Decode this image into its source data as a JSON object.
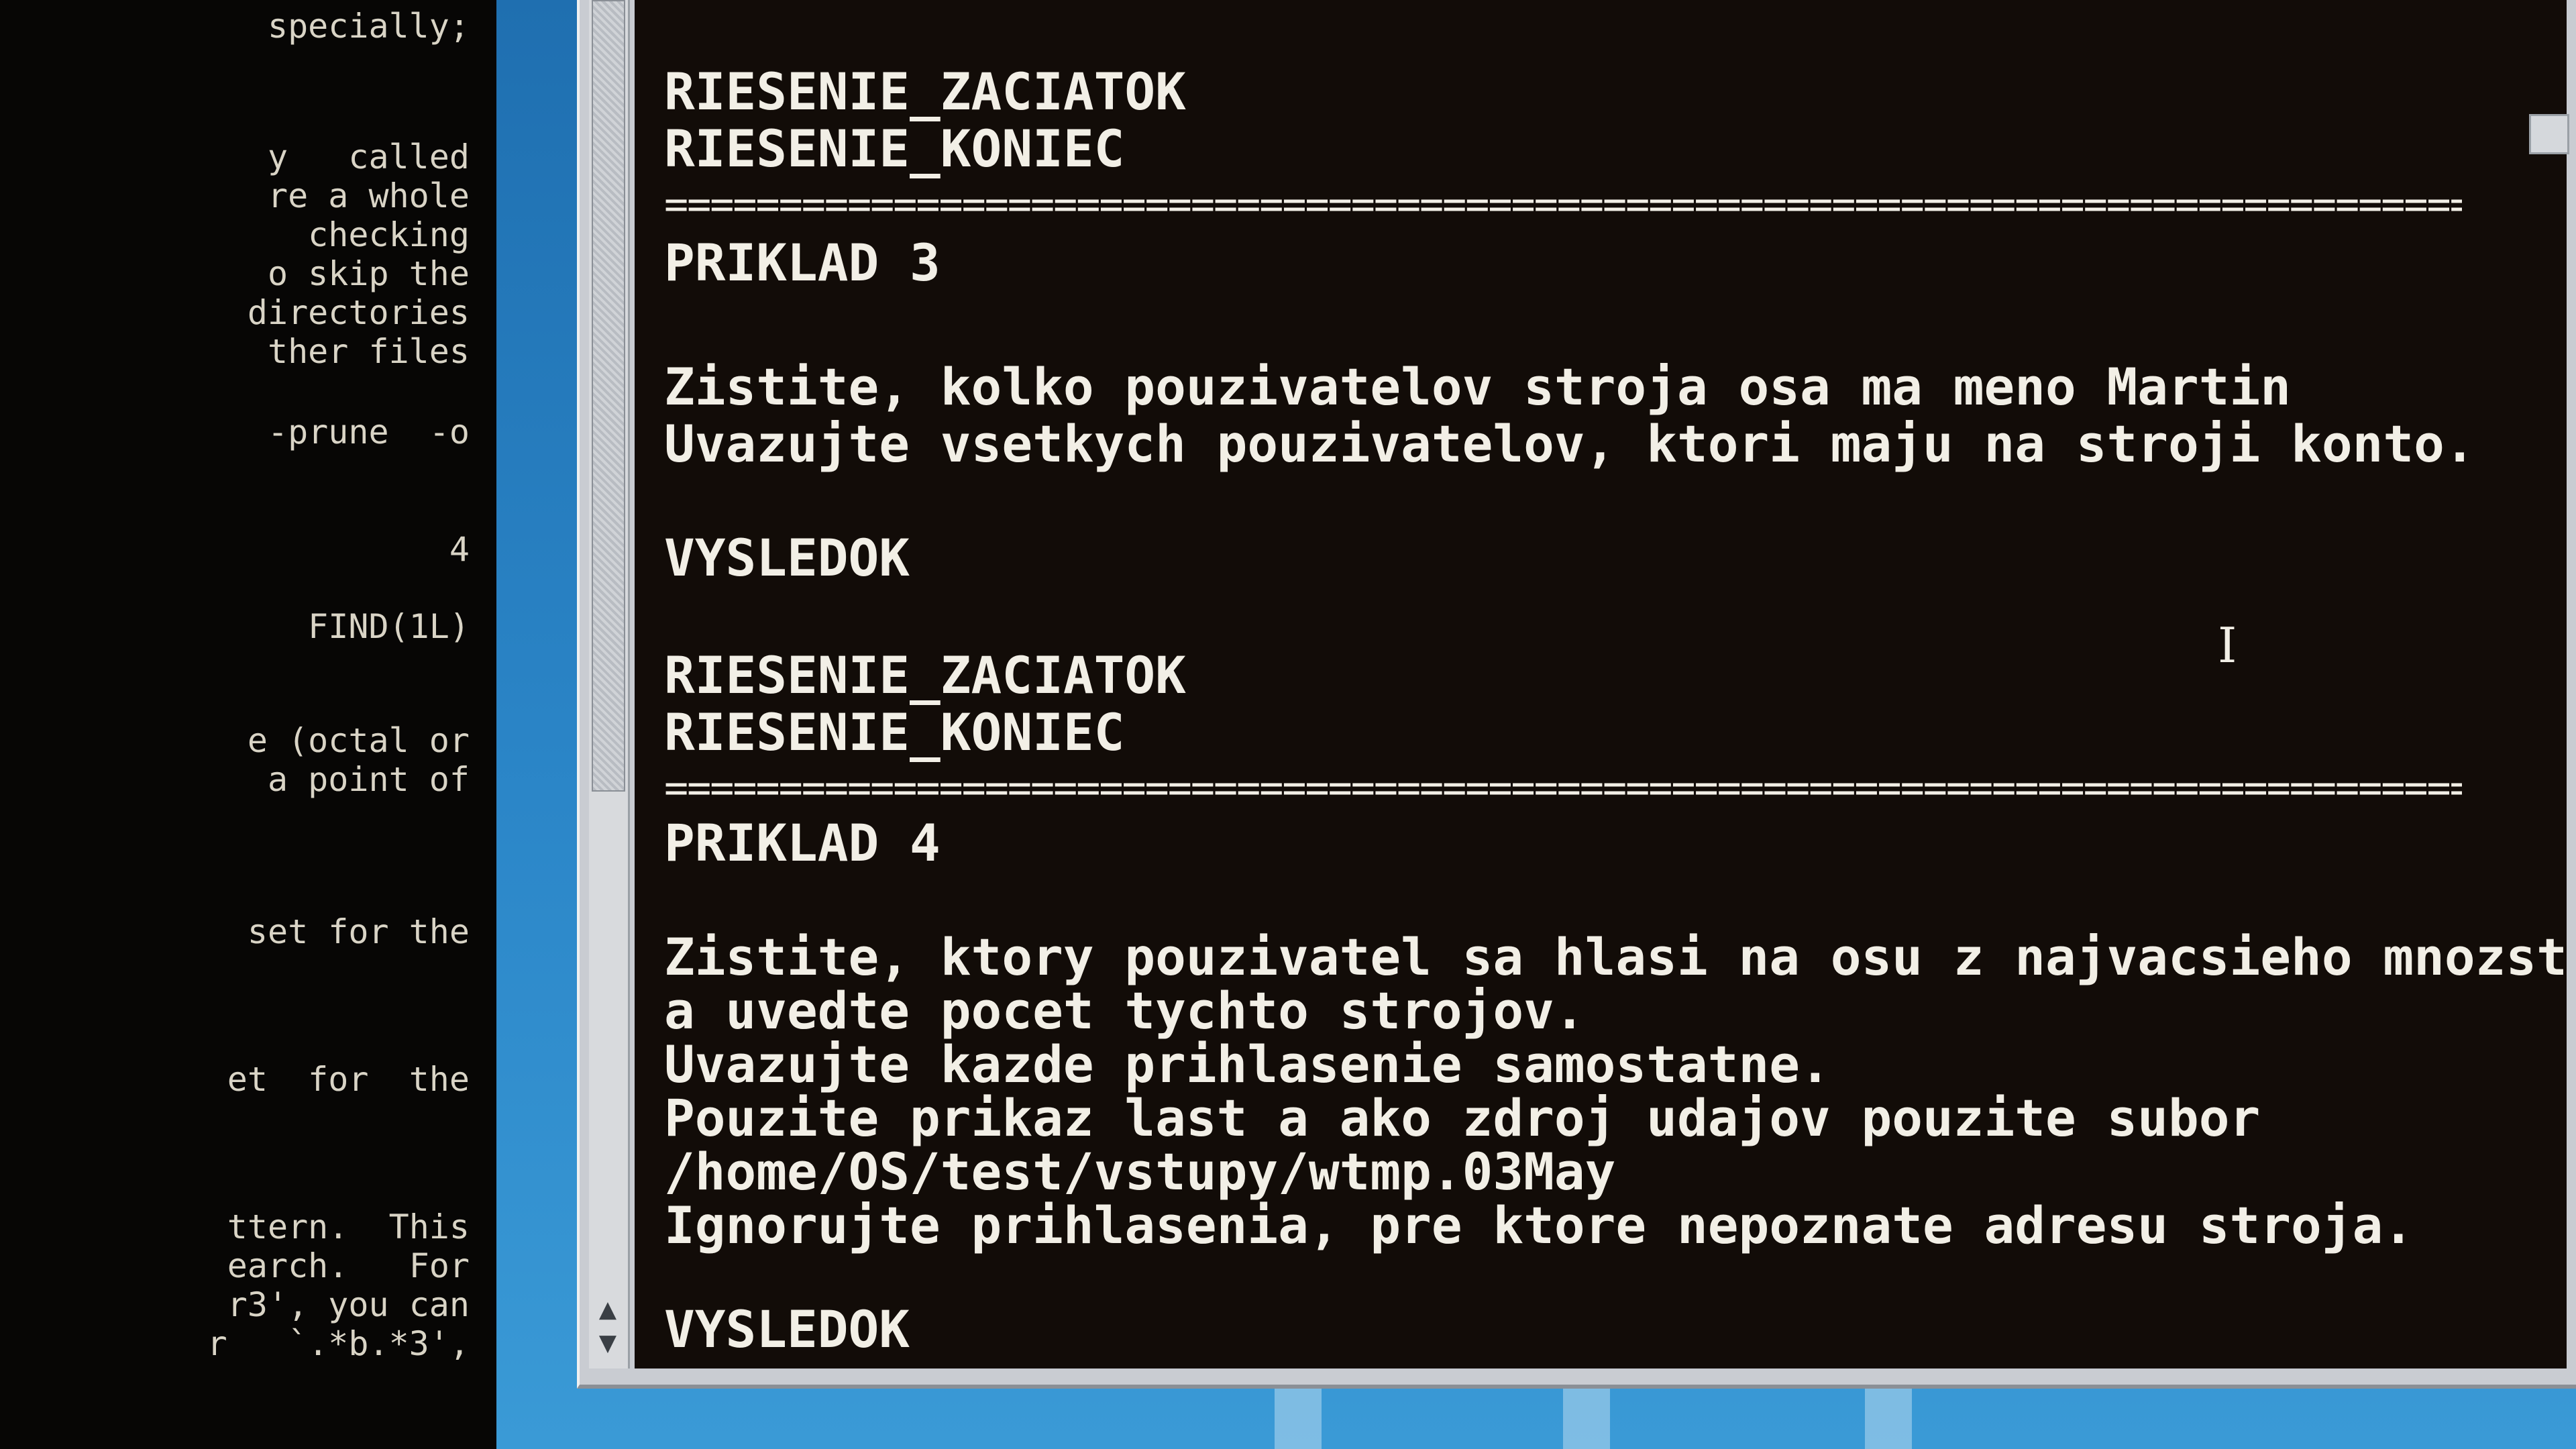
{
  "man_page": {
    "lines": [
      {
        "text": "specially;",
        "underline": false
      },
      {
        "text": "y   called",
        "underline": false
      },
      {
        "text": "re a whole",
        "underline": false
      },
      {
        "text": "  checking",
        "underline": false
      },
      {
        "text": "o skip the",
        "underline": false
      },
      {
        "text": "directories",
        "underline": false
      },
      {
        "text": "ther files",
        "underline": false
      },
      {
        "text": "-prune  -o",
        "underline": false
      },
      {
        "text": "4",
        "underline": false
      },
      {
        "text": "FIND(1L)",
        "underline": false
      },
      {
        "text": "e (octal or",
        "underline": false
      },
      {
        "text": " a point of",
        "underline": false
      },
      {
        "text": "set for the",
        "underline": false
      },
      {
        "text": "et  for  the",
        "underline": false
      },
      {
        "text": "ttern.  This",
        "underline": false
      },
      {
        "text": "earch.   For",
        "underline": false
      },
      {
        "text": "r3', you can",
        "underline": false
      },
      {
        "text": "r   `.*b.*3',",
        "underline": false
      }
    ]
  },
  "terminal": {
    "lines": [
      "RIESENIE_ZACIATOK",
      "RIESENIE_KONIEC",
      "PRIKLAD 3",
      "Zistite, kolko pouzivatelov stroja osa ma meno Martin",
      "Uvazujte vsetkych pouzivatelov, ktori maju na stroji konto.",
      "VYSLEDOK",
      "RIESENIE_ZACIATOK",
      "RIESENIE_KONIEC",
      "PRIKLAD 4",
      "Zistite, ktory pouzivatel sa hlasi na osu z najvacsieho mnozstva roznych strojov",
      "a uvedte pocet tychto strojov.",
      "Uvazujte kazde prihlasenie samostatne.",
      "Pouzite prikaz last a ako zdroj udajov pouzite subor",
      "/home/OS/test/vstupy/wtmp.03May",
      "Ignorujte prihlasenia, pre ktore nepoznate adresu stroja.",
      "VYSLEDOK"
    ],
    "separator": "================================================================================"
  },
  "icons": {
    "scroll_up": "▲",
    "scroll_down": "▼",
    "text_cursor": "I"
  },
  "colors": {
    "terminal_bg": "#120c08",
    "terminal_fg": "#f2efe6",
    "desktop": "#2b86c8"
  }
}
